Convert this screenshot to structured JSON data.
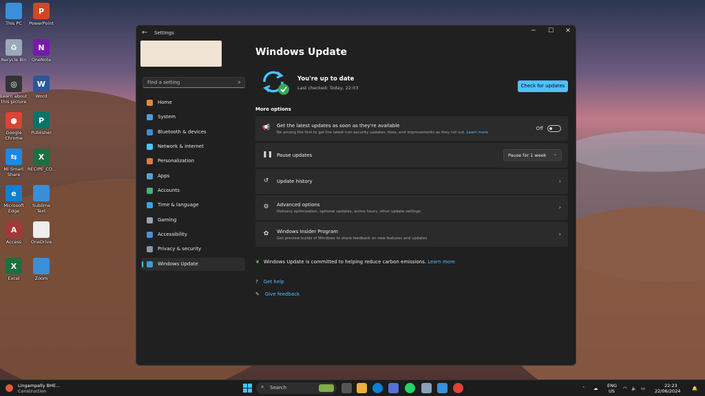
{
  "desktop": {
    "icons": [
      {
        "label": "This PC",
        "color": "#3a8fd8",
        "glyph": ""
      },
      {
        "label": "PowerPoint",
        "color": "#d24726",
        "glyph": "P"
      },
      {
        "label": "Recycle Bin",
        "color": "#9ab",
        "glyph": "♻"
      },
      {
        "label": "OneNote",
        "color": "#7719aa",
        "glyph": "N"
      },
      {
        "label": "Learn about this picture",
        "color": "#333",
        "glyph": "◎"
      },
      {
        "label": "Word",
        "color": "#2b579a",
        "glyph": "W"
      },
      {
        "label": "Google Chrome",
        "color": "#db4437",
        "glyph": "●"
      },
      {
        "label": "Publisher",
        "color": "#077568",
        "glyph": "P"
      },
      {
        "label": "Mi Smart Share",
        "color": "#1e88e5",
        "glyph": "⇆"
      },
      {
        "label": "RECIPE_CO...",
        "color": "#1d6f42",
        "glyph": "X"
      },
      {
        "label": "Microsoft Edge",
        "color": "#0f7fd1",
        "glyph": "e"
      },
      {
        "label": "Sublime Text",
        "color": "#3a8fd8",
        "glyph": ""
      },
      {
        "label": "Access",
        "color": "#a4373a",
        "glyph": "A"
      },
      {
        "label": "OneDrive",
        "color": "#eee",
        "glyph": ""
      },
      {
        "label": "Excel",
        "color": "#1d6f42",
        "glyph": "X"
      },
      {
        "label": "Zoom",
        "color": "#3a8fd8",
        "glyph": ""
      }
    ]
  },
  "window": {
    "title": "Settings",
    "back_icon": "←",
    "minimize": "─",
    "maximize": "☐",
    "close": "✕"
  },
  "sidebar": {
    "search_placeholder": "Find a setting",
    "items": [
      {
        "label": "Home",
        "color": "#e08a3c"
      },
      {
        "label": "System",
        "color": "#4a9fe0"
      },
      {
        "label": "Bluetooth & devices",
        "color": "#3b8fd6"
      },
      {
        "label": "Network & internet",
        "color": "#4cc2ff"
      },
      {
        "label": "Personalization",
        "color": "#e07b3c"
      },
      {
        "label": "Apps",
        "color": "#5aa0d8"
      },
      {
        "label": "Accounts",
        "color": "#46b07a"
      },
      {
        "label": "Time & language",
        "color": "#3da0e0"
      },
      {
        "label": "Gaming",
        "color": "#9aa4b0"
      },
      {
        "label": "Accessibility",
        "color": "#4c8fd8"
      },
      {
        "label": "Privacy & security",
        "color": "#8a96a4"
      },
      {
        "label": "Windows Update",
        "color": "#3a9ad8"
      }
    ]
  },
  "main": {
    "title": "Windows Update",
    "status_title": "You're up to date",
    "status_sub": "Last checked: Today, 22:03",
    "check_button": "Check for updates",
    "section_label": "More options",
    "cards": {
      "latest": {
        "title": "Get the latest updates as soon as they're available",
        "sub": "Be among the first to get the latest non-security updates, fixes, and improvements as they roll out.",
        "link": "Learn more",
        "toggle_label": "Off"
      },
      "pause": {
        "title": "Pause updates",
        "dropdown": "Pause for 1 week"
      },
      "history": {
        "title": "Update history"
      },
      "advanced": {
        "title": "Advanced options",
        "sub": "Delivery optimization, optional updates, active hours, other update settings"
      },
      "insider": {
        "title": "Windows Insider Program",
        "sub": "Get preview builds of Windows to share feedback on new features and updates"
      }
    },
    "carbon_text": "Windows Update is committed to helping reduce carbon emissions.",
    "carbon_link": "Learn more",
    "get_help": "Get help",
    "give_feedback": "Give feedback"
  },
  "taskbar": {
    "weather_title": "Lingampally BHE...",
    "weather_sub": "Construction",
    "search_placeholder": "Search",
    "lang": "ENG",
    "region": "US",
    "time": "22:23",
    "date": "22/06/2024"
  }
}
